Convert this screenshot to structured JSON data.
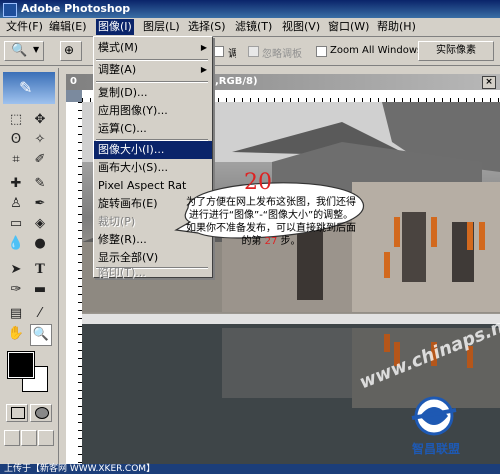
{
  "window": {
    "title": "Adobe Photoshop"
  },
  "menubar": {
    "items": [
      "文件(F)",
      "编辑(E)",
      "图像(I)",
      "图层(L)",
      "选择(S)",
      "滤镜(T)",
      "视图(V)",
      "窗口(W)",
      "帮助(H)"
    ],
    "active_index": 2
  },
  "options_bar": {
    "resize_label": "调整窗口大小以满屏显示",
    "ignore_palettes_label": "忽略调板",
    "zoom_all_label": "Zoom All Windows",
    "actual_pixels_button": "实际像素"
  },
  "document": {
    "title_left": "0",
    "title_right": ",RGB/8)"
  },
  "image_menu": {
    "items": [
      {
        "label": "模式(M)",
        "submenu": true,
        "state": "normal"
      },
      {
        "label": "调整(A)",
        "submenu": true,
        "state": "normal"
      },
      {
        "label": "复制(D)...",
        "state": "normal"
      },
      {
        "label": "应用图像(Y)...",
        "state": "normal"
      },
      {
        "label": "运算(C)...",
        "state": "normal"
      },
      {
        "label": "图像大小(I)...",
        "state": "highlighted"
      },
      {
        "label": "画布大小(S)...",
        "state": "normal"
      },
      {
        "label": "Pixel Aspect Rat",
        "state": "normal"
      },
      {
        "label": "旋转画布(E)",
        "state": "normal"
      },
      {
        "label": "裁切(P)",
        "state": "disabled"
      },
      {
        "label": "修整(R)...",
        "state": "normal"
      },
      {
        "label": "显示全部(V)",
        "state": "normal"
      },
      {
        "label": "陷印(T)...",
        "state": "disabled"
      }
    ]
  },
  "callout": {
    "number": "20",
    "text": "为了方便在网上发布这张图，我们还得进行进行“图像”-“图像大小”的调整。如果你不准备发布，可以直接跳到后面的第 27 步。"
  },
  "footer": {
    "status": "上传于【新客网 WWW.XKER.COM】"
  },
  "watermark": {
    "text": "www.chinaps.net",
    "logo_text": "智昌联盟"
  },
  "colors": {
    "menu_highlight": "#0a246a",
    "callout_number": "#dd2222",
    "callout_step": "#dd2222"
  }
}
